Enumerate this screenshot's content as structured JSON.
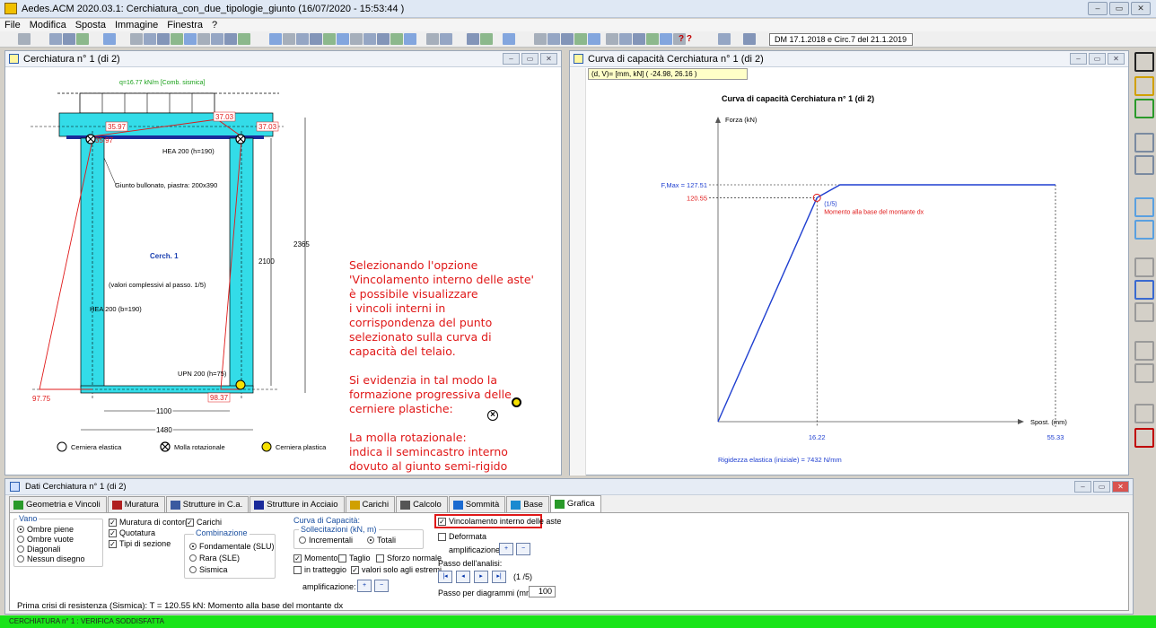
{
  "window": {
    "title": "Aedes.ACM 2020.03.1: Cerchiatura_con_due_tipologie_giunto  (16/07/2020 - 15:53:44 )"
  },
  "menu": [
    "File",
    "Modifica",
    "Sposta",
    "Immagine",
    "Finestra",
    "?"
  ],
  "toolbar": {
    "norm_text": "DM 17.1.2018 e Circ.7 del 21.1.2019",
    "help_text": "? ?"
  },
  "left_pane": {
    "title": "Cerchiatura n° 1 (di 2)",
    "drawing": {
      "load_label": "q=16.77 kN/m [Comb. sismica]",
      "vals_top": [
        "35.97",
        "37.03",
        "37.03",
        "35.97"
      ],
      "beam_label": "HEA 200 (h=190)",
      "joint_label": "Giunto bullonato, piastra: 200x390",
      "frame_name": "Cerch. 1",
      "note_label": "(valori complessivi al passo. 1/5)",
      "column_label": "HEA 200 (b=190)",
      "base_label": "UPN 200 (h=75)",
      "vals_bottom": [
        "97.75",
        "98.37"
      ],
      "dim_inner_h": "2100",
      "dim_outer_h": "2365",
      "dim_inner_w": "1100",
      "dim_outer_w": "1480",
      "legend": [
        "Cerniera elastica",
        "Molla rotazionale",
        "Cerniera plastica"
      ]
    },
    "note": "Selezionando l'opzione\n'Vincolamento interno delle aste'\nè possibile visualizzare\ni vincoli interni in\ncorrispondenza del punto\nselezionato sulla curva di\ncapacità del telaio.\n\nSi evidenzia in tal modo la\nformazione progressiva delle\ncerniere plastiche: \n\nLa molla rotazionale: \nindica il semincastro interno\ndovuto al giunto semi-rigido"
  },
  "right_pane": {
    "title": "Curva di capacità Cerchiatura n° 1 (di 2)",
    "coord_readout": "(d, V)= [mm, kN]  ( -24.98, 26.16 )"
  },
  "chart_data": {
    "type": "line",
    "title": "Curva di capacità Cerchiatura n° 1 (di 2)",
    "xlabel": "Spost. (mm)",
    "ylabel": "Forza (kN)",
    "x": [
      0,
      16.22,
      20,
      55.33
    ],
    "y": [
      0,
      120.55,
      127.51,
      127.51
    ],
    "xticks": [
      "16.22",
      "55.33"
    ],
    "yticks": [
      "F,Max = 127.51",
      "120.55"
    ],
    "xlim": [
      -10,
      70
    ],
    "ylim": [
      -20,
      155
    ],
    "marker": {
      "x": 16.22,
      "y": 120.55,
      "label1": "(1/5)",
      "label2": "Momento alla base del montante dx"
    },
    "stiffness_label": "Rigidezza elastica (iniziale) = 7432 N/mm",
    "series_color": "#1f3fd0"
  },
  "bottom_pane": {
    "title": "Dati Cerchiatura n° 1 (di 2)",
    "tabs": [
      "Geometria e Vincoli",
      "Muratura",
      "Strutture in C.a.",
      "Strutture in Acciaio",
      "Carichi",
      "Calcolo",
      "Sommità",
      "Base",
      "Grafica"
    ],
    "vano": {
      "label": "Vano",
      "options": [
        "Ombre piene",
        "Ombre vuote",
        "Diagonali",
        "Nessun disegno"
      ]
    },
    "checks1": [
      "Muratura di contorno",
      "Carichi",
      "Quotatura",
      "Tipi di sezione"
    ],
    "comb": {
      "label": "Combinazione",
      "options": [
        "Fondamentale (SLU)",
        "Rara (SLE)",
        "Sismica"
      ]
    },
    "curva": {
      "label": "Curva di Capacità:",
      "sub": "Sollecitazioni (kN, m)",
      "opt1": "Incrementali",
      "opt2": "Totali"
    },
    "checks2": [
      "Momento",
      "Taglio",
      "Sforzo normale",
      "in tratteggio",
      "valori solo agli estremi"
    ],
    "ampl_label": "amplificazione:",
    "vincolamento": "Vincolamento interno delle aste",
    "deformata": "Deformata",
    "ampl2": "amplificazione:",
    "passo_label": "Passo dell'analisi:",
    "passo_val": "(1 /5)",
    "passo_diag": "Passo per diagrammi (mm) =",
    "passo_diag_val": "100",
    "status": "Prima crisi di resistenza (Sismica): T = 120.55 kN: Momento alla base del montante dx"
  },
  "statusbar": {
    "text": "CERCHIATURA n° 1 : VERIFICA SODDISFATTA"
  }
}
